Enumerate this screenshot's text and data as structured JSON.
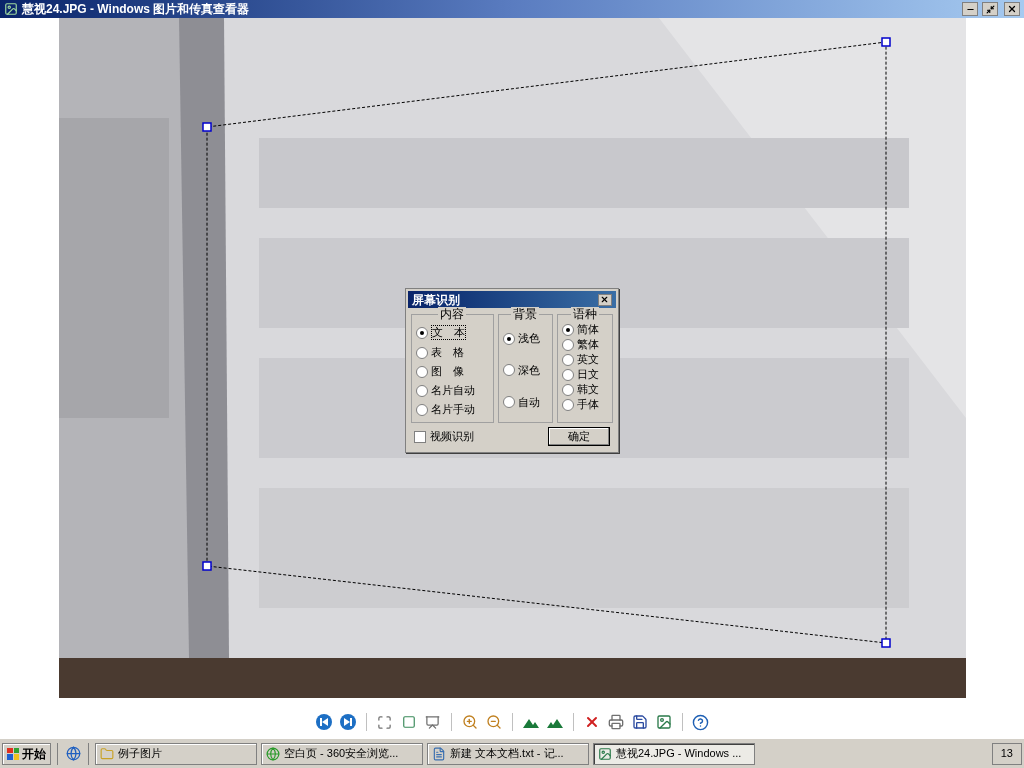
{
  "window": {
    "title": "慧视24.JPG - Windows 图片和传真查看器"
  },
  "dialog": {
    "title": "屏幕识别",
    "groups": [
      {
        "label": "内容",
        "options": [
          {
            "label": "文　本",
            "selected": true
          },
          {
            "label": "表　格",
            "selected": false
          },
          {
            "label": "图　像",
            "selected": false
          },
          {
            "label": "名片自动",
            "selected": false
          },
          {
            "label": "名片手动",
            "selected": false
          }
        ]
      },
      {
        "label": "背景",
        "options": [
          {
            "label": "浅色",
            "selected": true
          },
          {
            "label": "深色",
            "selected": false
          },
          {
            "label": "自动",
            "selected": false
          }
        ]
      },
      {
        "label": "语种",
        "options": [
          {
            "label": "简体",
            "selected": true
          },
          {
            "label": "繁体",
            "selected": false
          },
          {
            "label": "英文",
            "selected": false
          },
          {
            "label": "日文",
            "selected": false
          },
          {
            "label": "韩文",
            "selected": false
          },
          {
            "label": "手体",
            "selected": false
          }
        ]
      }
    ],
    "checkbox": {
      "label": "视频识别",
      "checked": false
    },
    "ok_button": "确定"
  },
  "taskbar": {
    "start": "开始",
    "items": [
      {
        "label": "例子图片",
        "kind": "folder",
        "selected": false
      },
      {
        "label": "空白页 - 360安全浏览...",
        "kind": "browser",
        "selected": false
      },
      {
        "label": "新建 文本文档.txt - 记...",
        "kind": "notepad",
        "selected": false
      },
      {
        "label": "慧视24.JPG - Windows ...",
        "kind": "viewer",
        "selected": true
      }
    ],
    "clock": "13"
  }
}
